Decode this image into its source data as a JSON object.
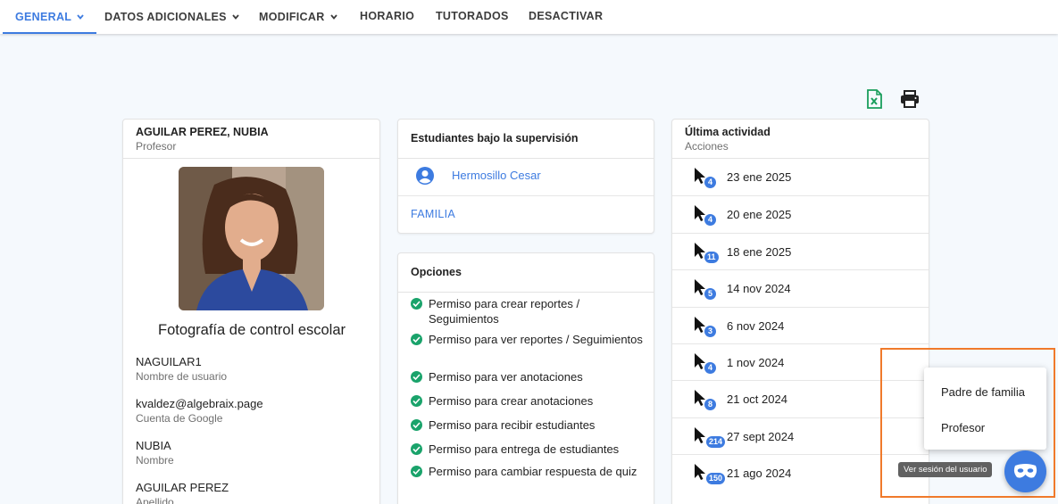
{
  "nav": {
    "tabs": [
      {
        "label": "GENERAL",
        "has_dropdown": true,
        "active": true
      },
      {
        "label": "DATOS ADICIONALES",
        "has_dropdown": true
      },
      {
        "label": "MODIFICAR",
        "has_dropdown": true
      },
      {
        "label": "HORARIO",
        "has_dropdown": false
      },
      {
        "label": "TUTORADOS",
        "has_dropdown": false
      },
      {
        "label": "DESACTIVAR",
        "has_dropdown": false
      }
    ]
  },
  "toolbar": {
    "excel_icon": "excel-icon",
    "print_icon": "print-icon",
    "excel_color": "#1a9e5c",
    "print_color": "#222222"
  },
  "profile": {
    "name": "AGUILAR PEREZ, NUBIA",
    "role": "Profesor",
    "photo_caption": "Fotografía de control escolar",
    "fields": [
      {
        "value": "NAGUILAR1",
        "label": "Nombre de usuario"
      },
      {
        "value": "kvaldez@algebraix.page",
        "label": "Cuenta de Google"
      },
      {
        "value": "NUBIA",
        "label": "Nombre"
      },
      {
        "value": "AGUILAR PEREZ",
        "label": "Apellido"
      }
    ]
  },
  "supervision": {
    "title": "Estudiantes bajo la supervisión",
    "students": [
      "Hermosillo Cesar"
    ],
    "family_link": "FAMILIA"
  },
  "options": {
    "title": "Opciones",
    "items": [
      "Permiso para crear reportes / Seguimientos",
      "Permiso para ver reportes / Seguimientos",
      "Permiso para ver anotaciones",
      "Permiso para crear anotaciones",
      "Permiso para recibir estudiantes",
      "Permiso para entrega de estudiantes",
      "Permiso para cambiar respuesta de quiz"
    ]
  },
  "activity": {
    "title": "Última actividad",
    "subtitle": "Acciones",
    "rows": [
      {
        "count": "4",
        "date": "23 ene 2025"
      },
      {
        "count": "4",
        "date": "20 ene 2025"
      },
      {
        "count": "11",
        "date": "18 ene 2025"
      },
      {
        "count": "5",
        "date": "14 nov 2024"
      },
      {
        "count": "3",
        "date": "6 nov 2024"
      },
      {
        "count": "4",
        "date": "1 nov 2024"
      },
      {
        "count": "8",
        "date": "21 oct 2024"
      },
      {
        "count": "214",
        "date": "27 sept 2024"
      },
      {
        "count": "150",
        "date": "21 ago 2024"
      }
    ]
  },
  "session_menu": {
    "items": [
      "Padre de familia",
      "Profesor"
    ],
    "tooltip": "Ver sesión del usuario",
    "fab_icon": "mask-icon",
    "highlight_color": "#f07a2b"
  },
  "colors": {
    "accent": "#3d7be0",
    "success": "#1aa36b",
    "background": "#f5f9fd"
  }
}
